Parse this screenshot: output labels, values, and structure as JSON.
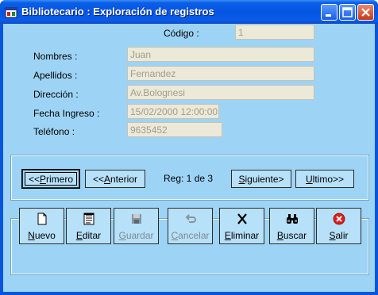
{
  "window": {
    "title": "Bibliotecario : Exploración de registros"
  },
  "form": {
    "codigo": {
      "label": "Código :",
      "value": "1"
    },
    "nombres": {
      "label": "Nombres :",
      "value": "Juan"
    },
    "apellidos": {
      "label": "Apellidos :",
      "value": "Fernandez"
    },
    "direccion": {
      "label": "Dirección :",
      "value": "Av.Bolognesi"
    },
    "fecha_ingreso": {
      "label": "Fecha Ingreso :",
      "value": "15/02/2000 12:00:00"
    },
    "telefono": {
      "label": "Teléfono :",
      "value": "9635452"
    }
  },
  "navigation": {
    "first": {
      "prefix": "<<",
      "mnemonic": "P",
      "rest": "rimero"
    },
    "previous": {
      "prefix": "<<",
      "mnemonic": "A",
      "rest": "nterior"
    },
    "record_status": "Reg: 1 de 3",
    "next": {
      "mnemonic": "S",
      "rest": "iguiente>"
    },
    "last": {
      "mnemonic": "U",
      "rest": "ltimo>>"
    }
  },
  "actions": [
    {
      "mnemonic": "N",
      "rest": "uevo",
      "icon": "new-document-icon",
      "enabled": true
    },
    {
      "mnemonic": "E",
      "rest": "ditar",
      "icon": "edit-icon",
      "enabled": true
    },
    {
      "mnemonic": "G",
      "rest": "uardar",
      "icon": "save-icon",
      "enabled": false
    },
    {
      "mnemonic": "C",
      "rest": "ancelar",
      "icon": "undo-icon",
      "enabled": false
    },
    {
      "mnemonic": "E",
      "rest": "liminar",
      "icon": "delete-icon",
      "enabled": true
    },
    {
      "mnemonic": "B",
      "rest": "uscar",
      "icon": "binoculars-icon",
      "enabled": true
    },
    {
      "mnemonic": "S",
      "rest": "alir",
      "icon": "exit-icon",
      "enabled": true
    }
  ],
  "colors": {
    "titlebar": "#0554e3",
    "client_background": "#9dd4f6",
    "button_background": "#b7e0f9",
    "disabled_field": "#ece9d8",
    "exit_red": "#e01c1c"
  }
}
